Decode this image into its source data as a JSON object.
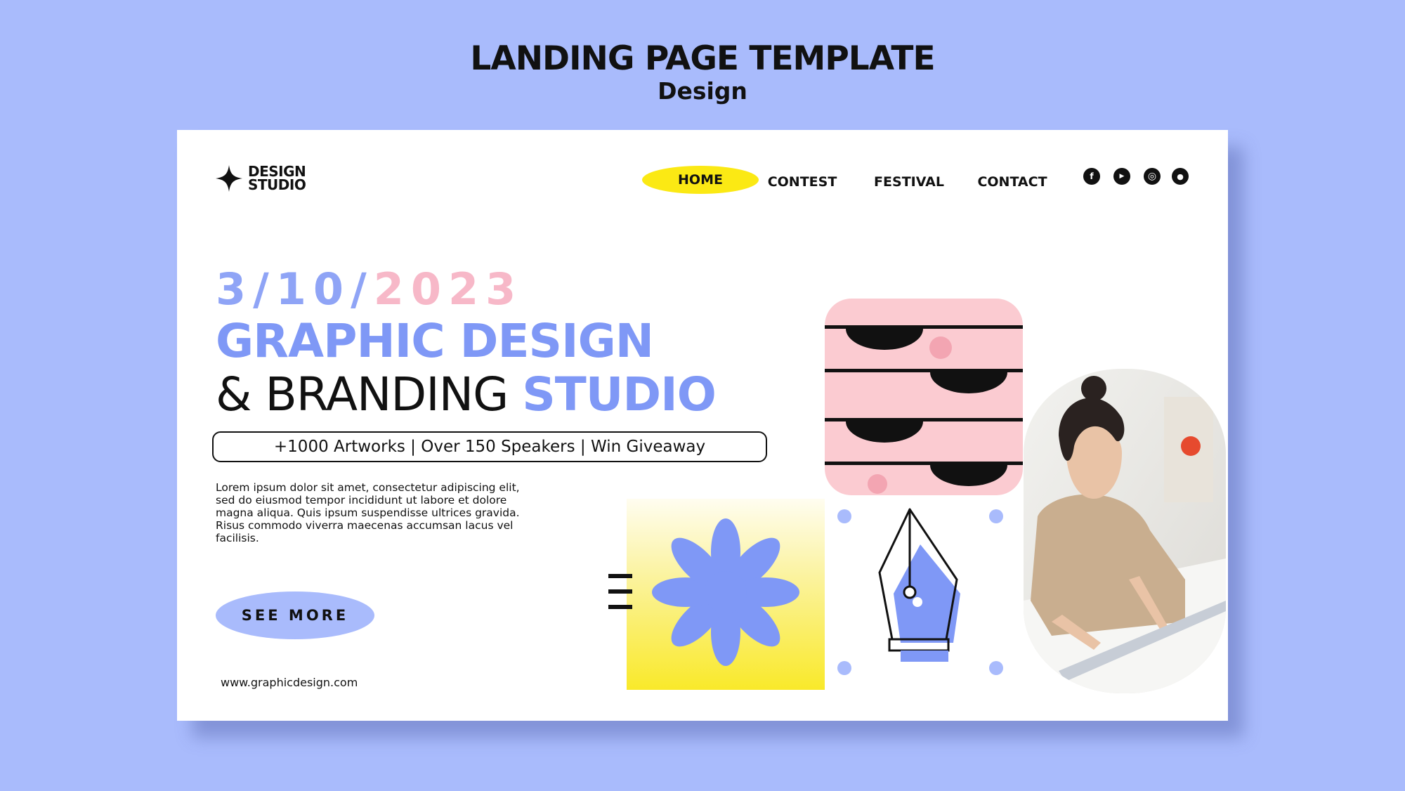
{
  "header": {
    "title": "LANDING PAGE TEMPLATE",
    "subtitle": "Design"
  },
  "logo": {
    "line1": "DESIGN",
    "line2": "STUDIO",
    "icon": "four-point-star-icon"
  },
  "nav": {
    "items": [
      {
        "label": "HOME",
        "active": true
      },
      {
        "label": "CONTEST",
        "active": false
      },
      {
        "label": "FESTIVAL",
        "active": false
      },
      {
        "label": "CONTACT",
        "active": false
      }
    ],
    "social": [
      {
        "icon": "facebook-icon",
        "glyph": "f"
      },
      {
        "icon": "youtube-icon",
        "glyph": "▶"
      },
      {
        "icon": "instagram-icon",
        "glyph": "◎"
      },
      {
        "icon": "user-icon",
        "glyph": "●"
      }
    ]
  },
  "hero": {
    "date_part1": "3/10/",
    "date_part2": "2023",
    "headline_line1": "GRAPHIC DESIGN",
    "headline_line2_plain": "& BRANDING ",
    "headline_line2_accent": "STUDIO",
    "tagline": "+1000 Artworks | Over 150 Speakers | Win Giveaway",
    "body": "Lorem ipsum dolor sit amet, consectetur adipiscing elit, sed do eiusmod tempor incididunt ut labore et dolore magna aliqua. Quis ipsum suspendisse ultrices gravida. Risus commodo viverra maecenas accumsan lacus vel facilisis.",
    "cta_label": "SEE MORE",
    "website": "www.graphicdesign.com"
  },
  "colors": {
    "background": "#a9bbfc",
    "accent_blue": "#7f98f6",
    "accent_pink": "#f7b8c8",
    "accent_yellow": "#fbe914",
    "text": "#111111"
  }
}
